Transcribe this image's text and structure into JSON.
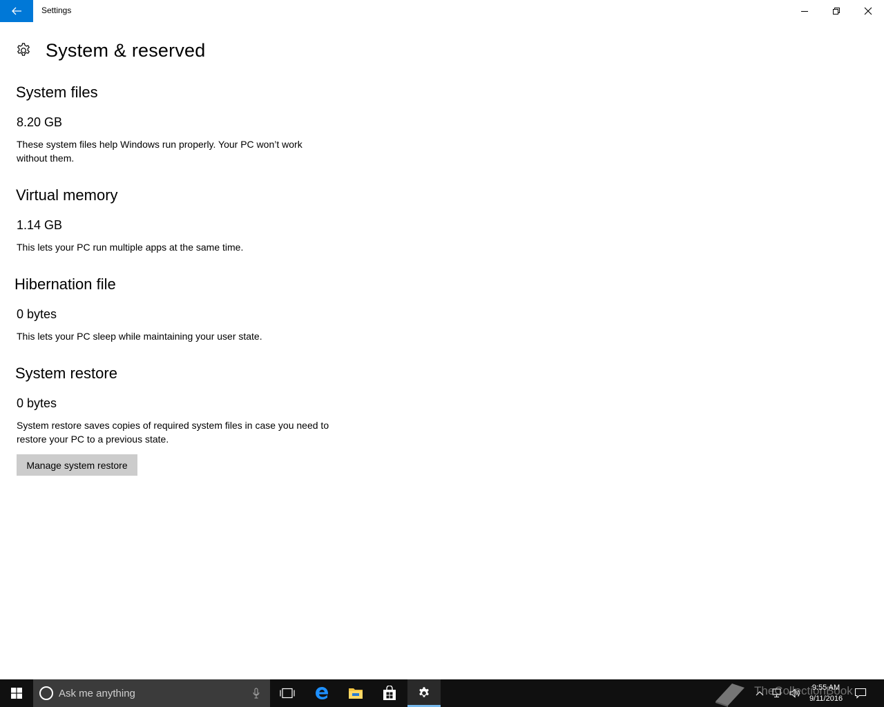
{
  "window": {
    "app_title": "Settings"
  },
  "page": {
    "title": "System & reserved"
  },
  "sections": [
    {
      "heading": "System files",
      "size": "8.20 GB",
      "description": "These system files help Windows run properly. Your PC won’t work without them."
    },
    {
      "heading": "Virtual memory",
      "size": "1.14 GB",
      "description": "This lets your PC run multiple apps at the same time."
    },
    {
      "heading": "Hibernation file",
      "size": "0 bytes",
      "description": "This lets your PC sleep while maintaining your user state."
    },
    {
      "heading": "System restore",
      "size": "0 bytes",
      "description": "System restore saves copies of required system files in case you need to restore your PC to a previous state."
    }
  ],
  "actions": {
    "manage_label": "Manage system restore"
  },
  "taskbar": {
    "search_placeholder": "Ask me anything",
    "time": "9:55 AM",
    "date": "9/11/2016",
    "watermark": "TheCollectionBook"
  },
  "colors": {
    "accent": "#0078d7",
    "taskbar": "#101010",
    "search_box": "#3b3b3b",
    "button": "#cccccc"
  }
}
